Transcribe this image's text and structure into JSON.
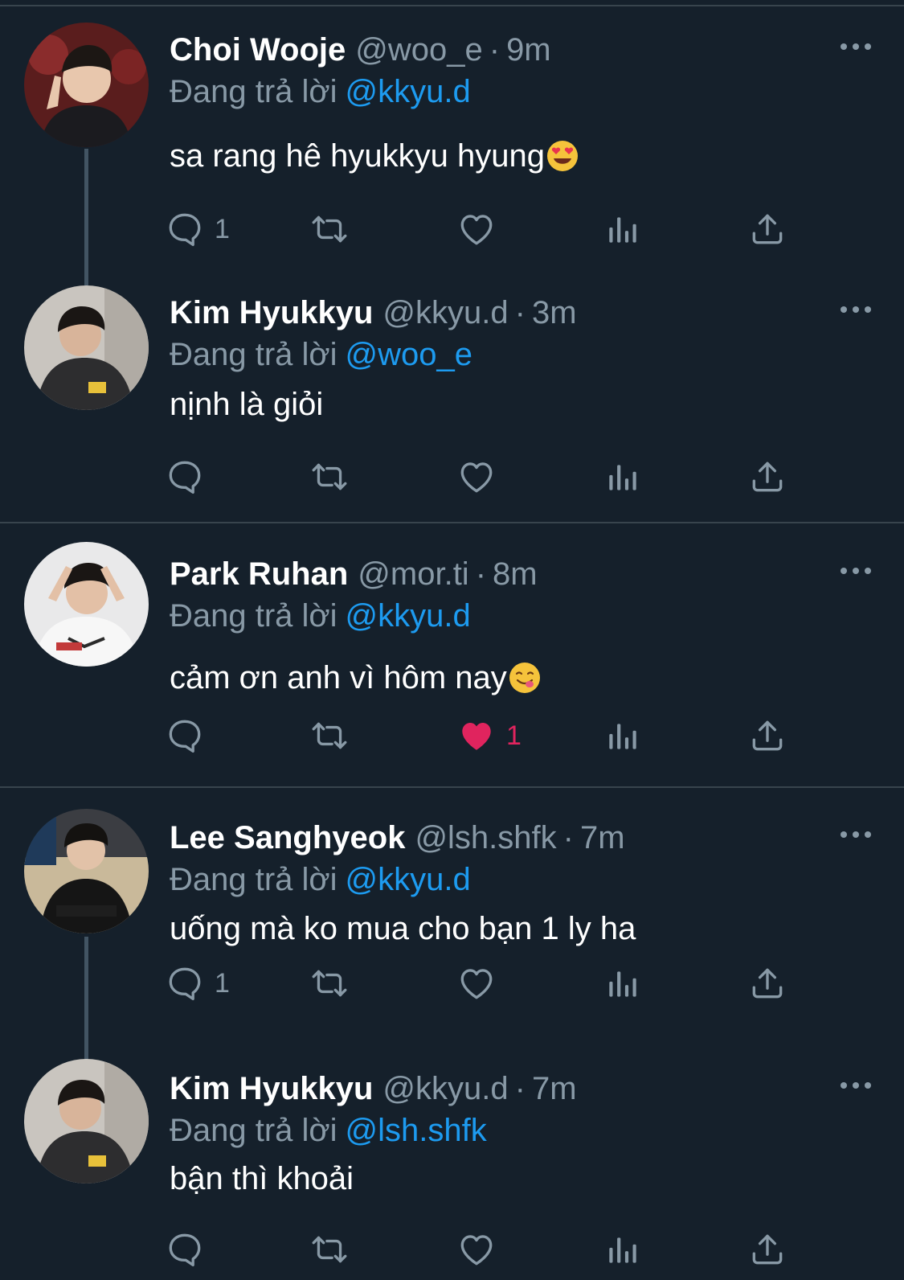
{
  "colors": {
    "background": "#15202b",
    "secondary_text": "#8899a6",
    "mention": "#1d9bf0",
    "like_active": "#e0245e",
    "divider": "#38444d"
  },
  "icons": [
    "reply-icon",
    "retweet-icon",
    "like-icon",
    "analytics-icon",
    "share-icon",
    "more-icon"
  ],
  "tweets": [
    {
      "name": "Choi Wooje",
      "handle": "@woo_e",
      "dot": "·",
      "time": "9m",
      "reply_prefix": "Đang trả lời",
      "reply_to": "@kkyu.d",
      "text": "sa rang hê hyukkyu hyung",
      "emoji": "heart-eyes-emoji",
      "reply_count": "1",
      "like_count": "",
      "liked": false
    },
    {
      "name": "Kim Hyukkyu",
      "handle": "@kkyu.d",
      "dot": "·",
      "time": "3m",
      "reply_prefix": "Đang trả lời",
      "reply_to": "@woo_e",
      "text": "nịnh là giỏi",
      "reply_count": "",
      "like_count": "",
      "liked": false
    },
    {
      "name": "Park Ruhan",
      "handle": "@mor.ti",
      "dot": "·",
      "time": "8m",
      "reply_prefix": "Đang trả lời",
      "reply_to": "@kkyu.d",
      "text": "cảm ơn anh vì hôm nay",
      "emoji": "yum-emoji",
      "reply_count": "",
      "like_count": "1",
      "liked": true
    },
    {
      "name": "Lee Sanghyeok",
      "handle": "@lsh.shfk",
      "dot": "·",
      "time": "7m",
      "reply_prefix": "Đang trả lời",
      "reply_to": "@kkyu.d",
      "text": "uống mà ko mua cho bạn 1 ly ha",
      "reply_count": "1",
      "like_count": "",
      "liked": false
    },
    {
      "name": "Kim Hyukkyu",
      "handle": "@kkyu.d",
      "dot": "·",
      "time": "7m",
      "reply_prefix": "Đang trả lời",
      "reply_to": "@lsh.shfk",
      "text": "bận thì khoải",
      "reply_count": "",
      "like_count": "",
      "liked": false
    }
  ]
}
